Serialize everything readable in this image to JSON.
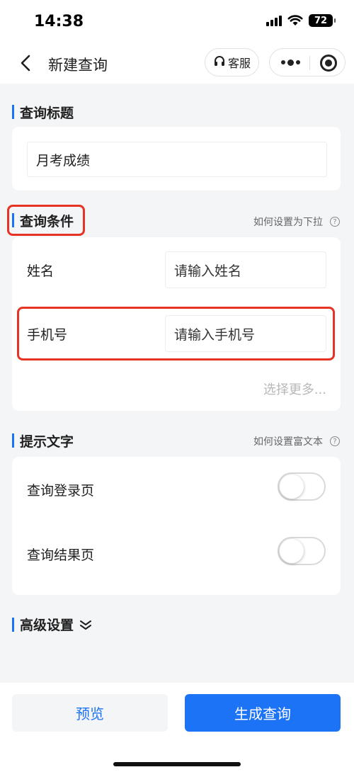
{
  "status": {
    "time": "14:38",
    "battery": "72"
  },
  "nav": {
    "title": "新建查询",
    "service_label": "客服"
  },
  "sections": {
    "title": {
      "heading": "查询标题",
      "value": "月考成绩"
    },
    "conditions": {
      "heading": "查询条件",
      "help": "如何设置为下拉",
      "rows": [
        {
          "label": "姓名",
          "placeholder": "请输入姓名"
        },
        {
          "label": "手机号",
          "placeholder": "请输入手机号"
        }
      ],
      "more": "选择更多..."
    },
    "hints": {
      "heading": "提示文字",
      "help": "如何设置富文本",
      "rows": [
        {
          "label": "查询登录页",
          "enabled": false
        },
        {
          "label": "查询结果页",
          "enabled": false
        }
      ]
    },
    "advanced": {
      "heading": "高级设置"
    }
  },
  "footer": {
    "preview": "预览",
    "generate": "生成查询"
  },
  "colors": {
    "accent": "#1d73f5",
    "highlight": "#e63323",
    "background": "#f4f5f7"
  }
}
